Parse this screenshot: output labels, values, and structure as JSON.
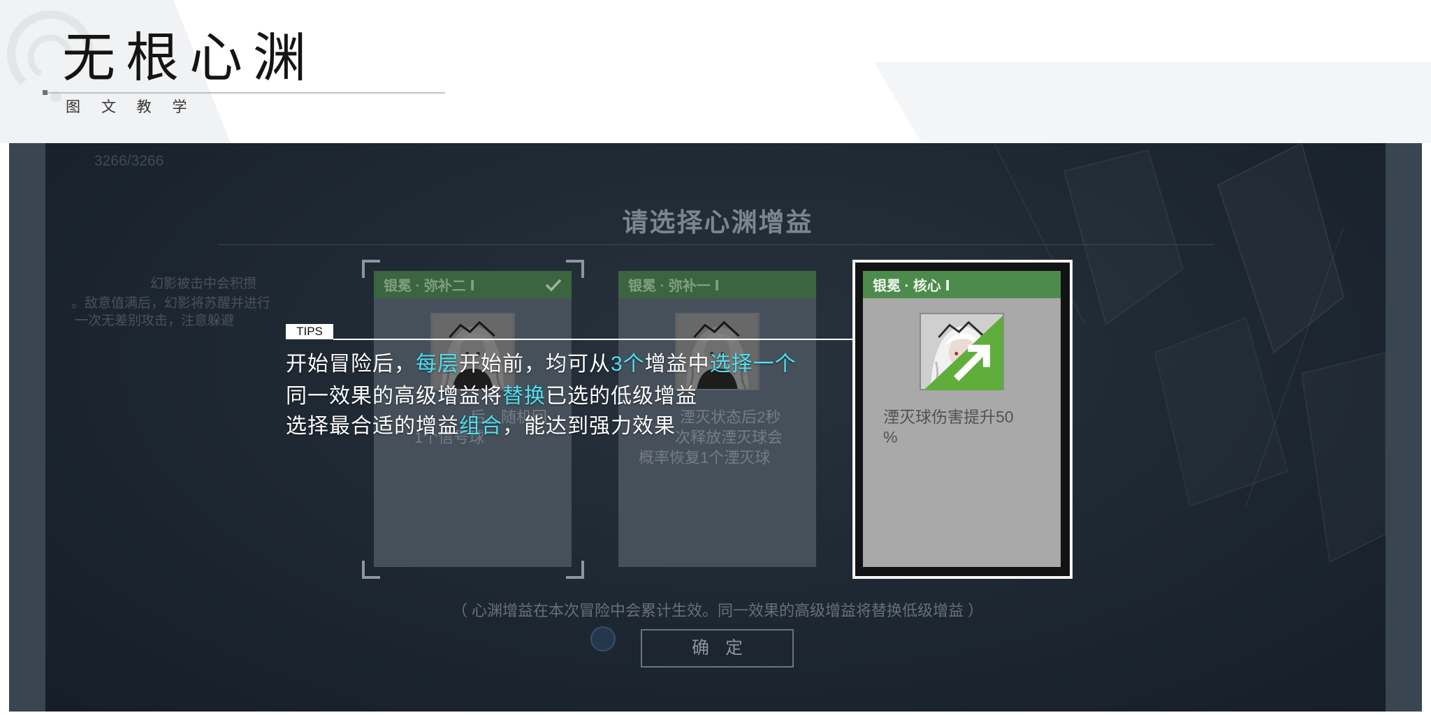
{
  "header": {
    "title": "无根心渊",
    "subtitle": "图 文 教 学"
  },
  "game": {
    "hp_text": "3266/3266",
    "panel_title": "请选择心渊增益",
    "side_hint_lines": [
      "幻影被击中会积攒",
      "。敌意值满后，幻影将苏醒并进行",
      "一次无差别攻击，注意躲避"
    ],
    "cards": [
      {
        "title": "银冕 · 弥补二 Ⅰ",
        "checked": true,
        "highlighted": false,
        "desc_lines": [
          "后，随机回",
          "1个信号球"
        ]
      },
      {
        "title": "银冕 · 弥补一 Ⅰ",
        "checked": false,
        "highlighted": false,
        "desc_lines": [
          "湮灭状态后2秒",
          "次释放湮灭球会",
          "概率恢复1个湮灭球"
        ]
      },
      {
        "title": "银冕 · 核心 Ⅰ",
        "checked": false,
        "highlighted": true,
        "desc_lines": [
          "湮灭球伤害提升50",
          "%"
        ]
      }
    ],
    "footer_note": "（ 心渊增益在本次冒险中会累计生效。同一效果的高级增益将替换低级增益 ）",
    "confirm_label": "确 定"
  },
  "tips": {
    "label": "TIPS",
    "lines": [
      [
        {
          "text": "开始冒险后，",
          "highlight": false
        },
        {
          "text": "每层",
          "highlight": true
        },
        {
          "text": "开始前，均可从",
          "highlight": false
        },
        {
          "text": "3个",
          "highlight": true
        },
        {
          "text": "增益中",
          "highlight": false
        },
        {
          "text": "选择一个",
          "highlight": true
        }
      ],
      [
        {
          "text": "同一效果的高级增益将",
          "highlight": false
        },
        {
          "text": "替换",
          "highlight": true
        },
        {
          "text": "已选的低级增益",
          "highlight": false
        }
      ],
      [
        {
          "text": "选择最合适的增益",
          "highlight": false
        },
        {
          "text": "组合",
          "highlight": true
        },
        {
          "text": "，能达到强力效果",
          "highlight": false
        }
      ]
    ]
  },
  "icons": {
    "logo": "watermark-logo-icon",
    "card_check": "check-icon",
    "card_portrait": "portrait-icon",
    "card_badge": "upgrade-arrow-icon"
  },
  "colors": {
    "highlight": "#4fe0f0",
    "card_header_green": "#4c8b4c",
    "panel_bg": "#1e2832"
  }
}
